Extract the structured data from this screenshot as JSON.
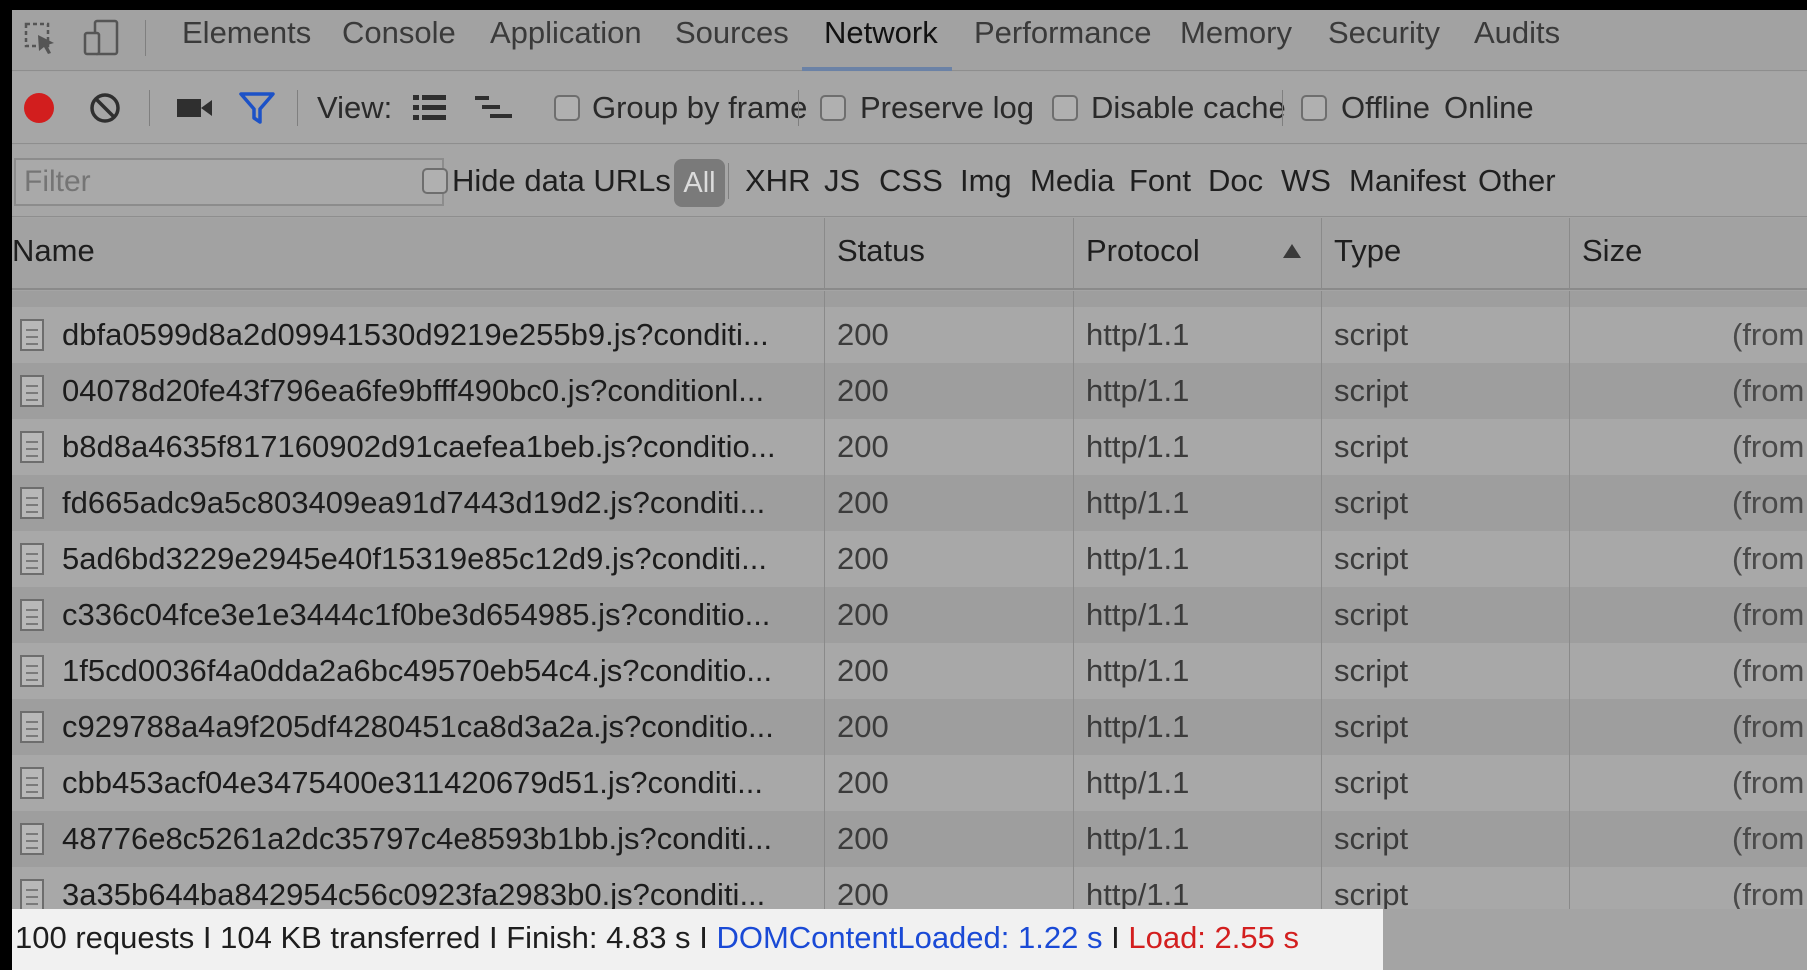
{
  "tabs": [
    {
      "label": "Elements"
    },
    {
      "label": "Console"
    },
    {
      "label": "Application"
    },
    {
      "label": "Sources"
    },
    {
      "label": "Network",
      "active": true
    },
    {
      "label": "Performance"
    },
    {
      "label": "Memory"
    },
    {
      "label": "Security"
    },
    {
      "label": "Audits"
    }
  ],
  "toolbar": {
    "view_label": "View:",
    "group_by_frame": {
      "label": "Group by frame",
      "checked": false
    },
    "preserve_log": {
      "label": "Preserve log",
      "checked": false
    },
    "disable_cache": {
      "label": "Disable cache",
      "checked": false
    },
    "offline": {
      "label": "Offline",
      "checked": false
    },
    "throttle": "Online"
  },
  "filter": {
    "placeholder": "Filter",
    "value": "",
    "hide_data_urls": {
      "label": "Hide data URLs",
      "checked": false
    },
    "types": [
      "All",
      "XHR",
      "JS",
      "CSS",
      "Img",
      "Media",
      "Font",
      "Doc",
      "WS",
      "Manifest",
      "Other"
    ],
    "active_type": "All"
  },
  "table": {
    "columns": [
      "Name",
      "Status",
      "Protocol",
      "Type",
      "Size"
    ],
    "sorted_column": "Protocol",
    "sort_direction": "ascending",
    "rows": [
      {
        "name": "dbfa0599d8a2d09941530d9219e255b9.js?conditi...",
        "status": "200",
        "protocol": "http/1.1",
        "type": "script",
        "size": "(from"
      },
      {
        "name": "04078d20fe43f796ea6fe9bfff490bc0.js?conditionl...",
        "status": "200",
        "protocol": "http/1.1",
        "type": "script",
        "size": "(from"
      },
      {
        "name": "b8d8a4635f817160902d91caefea1beb.js?conditio...",
        "status": "200",
        "protocol": "http/1.1",
        "type": "script",
        "size": "(from"
      },
      {
        "name": "fd665adc9a5c803409ea91d7443d19d2.js?conditi...",
        "status": "200",
        "protocol": "http/1.1",
        "type": "script",
        "size": "(from"
      },
      {
        "name": "5ad6bd3229e2945e40f15319e85c12d9.js?conditi...",
        "status": "200",
        "protocol": "http/1.1",
        "type": "script",
        "size": "(from"
      },
      {
        "name": "c336c04fce3e1e3444c1f0be3d654985.js?conditio...",
        "status": "200",
        "protocol": "http/1.1",
        "type": "script",
        "size": "(from"
      },
      {
        "name": "1f5cd0036f4a0dda2a6bc49570eb54c4.js?conditio...",
        "status": "200",
        "protocol": "http/1.1",
        "type": "script",
        "size": "(from"
      },
      {
        "name": "c929788a4a9f205df4280451ca8d3a2a.js?conditio...",
        "status": "200",
        "protocol": "http/1.1",
        "type": "script",
        "size": "(from"
      },
      {
        "name": "cbb453acf04e3475400e311420679d51.js?conditi...",
        "status": "200",
        "protocol": "http/1.1",
        "type": "script",
        "size": "(from"
      },
      {
        "name": "48776e8c5261a2dc35797c4e8593b1bb.js?conditi...",
        "status": "200",
        "protocol": "http/1.1",
        "type": "script",
        "size": "(from"
      },
      {
        "name": "3a35b644ba842954c56c0923fa2983b0.js?conditi...",
        "status": "200",
        "protocol": "http/1.1",
        "type": "script",
        "size": "(from"
      }
    ]
  },
  "status": {
    "requests": "100 requests",
    "transferred": "104 KB transferred",
    "finish": "Finish: 4.83 s",
    "dom_content_loaded": "DOMContentLoaded: 1.22 s",
    "load": "Load: 2.55 s",
    "separator": "I"
  },
  "colors": {
    "record": "#d21e1e",
    "filter_icon": "#1c52c7",
    "dom_content_loaded": "#1a4ad6",
    "load": "#d31f1f"
  },
  "icons": [
    "select-element-icon",
    "device-toolbar-icon",
    "record-icon",
    "clear-icon",
    "screenshot-icon",
    "filter-icon",
    "list-view-icon",
    "waterfall-view-icon",
    "sort-ascending-icon",
    "file-icon"
  ]
}
